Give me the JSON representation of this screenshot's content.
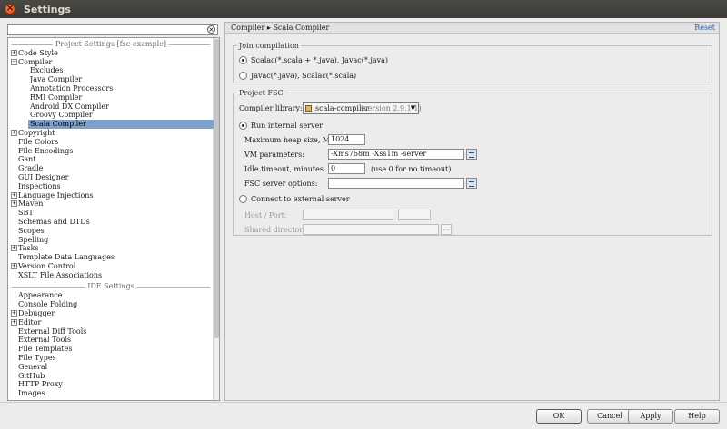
{
  "window": {
    "title": "Settings"
  },
  "search": {
    "value": ""
  },
  "tree": {
    "project_section": "Project Settings [fsc-example]",
    "ide_section": "IDE Settings",
    "project_items": [
      {
        "label": "Code Style",
        "exp": "+",
        "level": 0
      },
      {
        "label": "Compiler",
        "exp": "−",
        "level": 0
      },
      {
        "label": "Excludes",
        "level": 1
      },
      {
        "label": "Java Compiler",
        "level": 1
      },
      {
        "label": "Annotation Processors",
        "level": 1
      },
      {
        "label": "RMI Compiler",
        "level": 1
      },
      {
        "label": "Android DX Compiler",
        "level": 1
      },
      {
        "label": "Groovy Compiler",
        "level": 1
      },
      {
        "label": "Scala Compiler",
        "level": 1,
        "selected": true
      },
      {
        "label": "Copyright",
        "exp": "+",
        "level": 0
      },
      {
        "label": "File Colors",
        "level": 0
      },
      {
        "label": "File Encodings",
        "level": 0
      },
      {
        "label": "Gant",
        "level": 0
      },
      {
        "label": "Gradle",
        "level": 0
      },
      {
        "label": "GUI Designer",
        "level": 0
      },
      {
        "label": "Inspections",
        "level": 0
      },
      {
        "label": "Language Injections",
        "exp": "+",
        "level": 0
      },
      {
        "label": "Maven",
        "exp": "+",
        "level": 0
      },
      {
        "label": "SBT",
        "level": 0
      },
      {
        "label": "Schemas and DTDs",
        "level": 0
      },
      {
        "label": "Scopes",
        "level": 0
      },
      {
        "label": "Spelling",
        "level": 0
      },
      {
        "label": "Tasks",
        "exp": "+",
        "level": 0
      },
      {
        "label": "Template Data Languages",
        "level": 0
      },
      {
        "label": "Version Control",
        "exp": "+",
        "level": 0
      },
      {
        "label": "XSLT File Associations",
        "level": 0
      }
    ],
    "ide_items": [
      {
        "label": "Appearance",
        "level": 0
      },
      {
        "label": "Console Folding",
        "level": 0
      },
      {
        "label": "Debugger",
        "exp": "+",
        "level": 0
      },
      {
        "label": "Editor",
        "exp": "+",
        "level": 0
      },
      {
        "label": "External Diff Tools",
        "level": 0
      },
      {
        "label": "External Tools",
        "level": 0
      },
      {
        "label": "File Templates",
        "level": 0
      },
      {
        "label": "File Types",
        "level": 0
      },
      {
        "label": "General",
        "level": 0
      },
      {
        "label": "GitHub",
        "level": 0
      },
      {
        "label": "HTTP Proxy",
        "level": 0
      },
      {
        "label": "Images",
        "level": 0
      }
    ]
  },
  "header": {
    "crumb_parent": "Compiler",
    "crumb_sep": "▸",
    "crumb_current": "Scala Compiler",
    "reset": "Reset"
  },
  "join": {
    "title": "Join compilation",
    "opt1": "Scalac(*.scala + *.java), Javac(*.java)",
    "opt2": "Javac(*.java), Scalac(*.scala)"
  },
  "fsc": {
    "title": "Project FSC",
    "lib_label": "Compiler library:",
    "lib_value": "scala-compiler",
    "lib_version": "(version 2.9.1-1)",
    "run_internal": "Run internal server",
    "heap_label": "Maximum heap size, MB:",
    "heap_value": "1024",
    "vm_label": "VM parameters:",
    "vm_value": "-Xms768m -Xss1m -server",
    "idle_label": "Idle timeout, minutes",
    "idle_value": "0",
    "idle_hint": "(use 0 for no timeout)",
    "opts_label": "FSC server options:",
    "opts_value": "",
    "connect_external": "Connect to external server",
    "host_label": "Host / Port:",
    "shared_label": "Shared directory:",
    "browse": "..."
  },
  "buttons": {
    "ok": "OK",
    "cancel": "Cancel",
    "apply": "Apply",
    "help": "Help"
  }
}
